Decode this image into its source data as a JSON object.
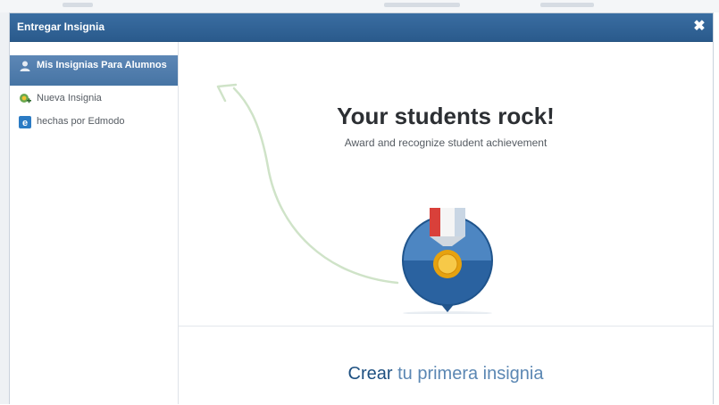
{
  "window": {
    "title": "Entregar Insignia",
    "close_icon": "close-icon"
  },
  "sidebar": {
    "items": [
      {
        "label": "Mis Insignias Para Alumnos",
        "icon": "user-icon",
        "active": true
      },
      {
        "label": "Nueva Insignia",
        "icon": "badge-add-icon",
        "active": false
      },
      {
        "label": "hechas por Edmodo",
        "icon": "edmodo-icon",
        "active": false
      }
    ]
  },
  "main": {
    "headline": "Your students rock!",
    "subline": "Award and recognize student achievement",
    "badge_icon": "medal-badge-icon",
    "cta": {
      "link": "Crear",
      "rest": "tu primera insignia"
    }
  },
  "colors": {
    "titlebar": "#2f6394",
    "active_item": "#4f7cac",
    "cta_link": "#1e5081",
    "cta_text": "#5b87b3",
    "arrow": "#cfe3c8"
  }
}
